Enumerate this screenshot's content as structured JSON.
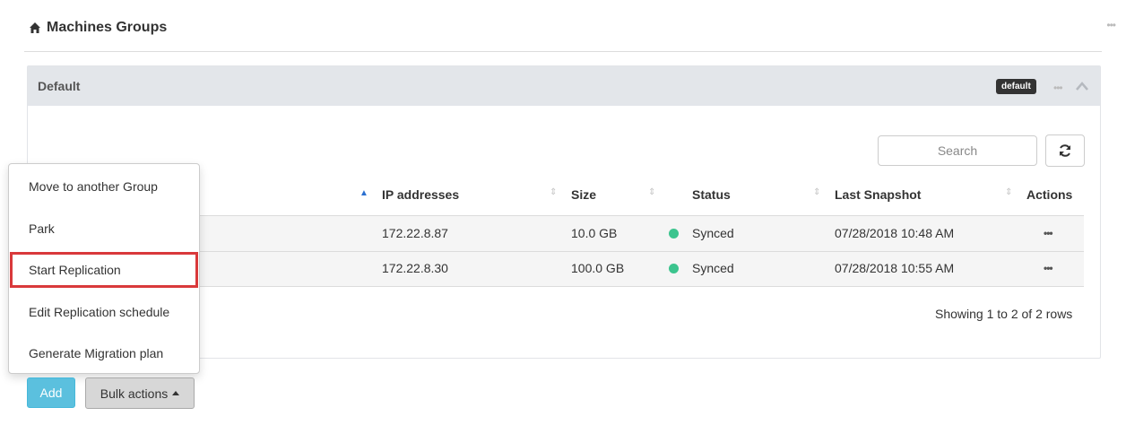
{
  "page": {
    "title": "Machines Groups",
    "menu_dots": "•••"
  },
  "group": {
    "title": "Default",
    "badge": "default",
    "menu_dots": "•••"
  },
  "toolbar": {
    "search_placeholder": "Search"
  },
  "table": {
    "columns": [
      {
        "label": "IP addresses",
        "sort": "asc"
      },
      {
        "label": "Size",
        "sort": "none"
      },
      {
        "label": "Status",
        "sort": "none"
      },
      {
        "label": "Last Snapshot",
        "sort": "none"
      },
      {
        "label": "Actions",
        "sort": "none"
      }
    ],
    "rows": [
      {
        "ip": "172.22.8.87",
        "size": "10.0 GB",
        "status": "Synced",
        "last_snapshot": "07/28/2018 10:48 AM",
        "actions": "•••"
      },
      {
        "ip": "172.22.8.30",
        "size": "100.0 GB",
        "status": "Synced",
        "last_snapshot": "07/28/2018 10:55 AM",
        "actions": "•••"
      }
    ],
    "pagination": "Showing 1 to 2 of 2 rows"
  },
  "bulk_menu": {
    "items": [
      {
        "label": "Move to another Group"
      },
      {
        "label": "Park"
      },
      {
        "label": "Start Replication",
        "highlighted": true
      },
      {
        "label": "Edit Replication schedule"
      },
      {
        "label": "Generate Migration plan"
      }
    ]
  },
  "buttons": {
    "add": "Add",
    "bulk_actions": "Bulk actions"
  },
  "colors": {
    "status_synced": "#3cc48e",
    "add_button": "#5bc0de",
    "highlight_border": "#d9393b",
    "panel_header": "#e3e6ea"
  },
  "icons": [
    "home-icon",
    "refresh-icon",
    "chevron-up-icon",
    "sort-asc-icon",
    "sort-icon",
    "caret-up-icon",
    "more-dots-icon"
  ]
}
